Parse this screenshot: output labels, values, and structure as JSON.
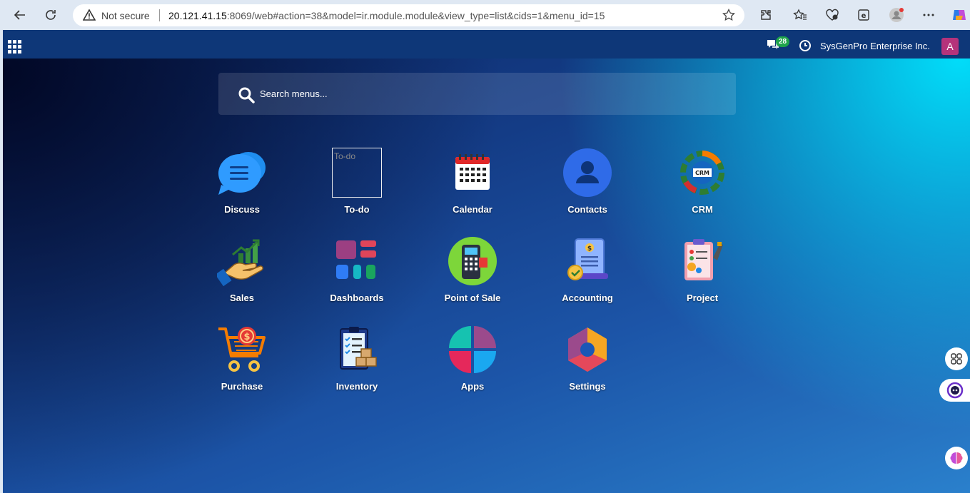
{
  "browser": {
    "security_label": "Not secure",
    "url_host": "20.121.41.15",
    "url_rest": ":8069/web#action=38&model=ir.module.module&view_type=list&cids=1&menu_id=15"
  },
  "navbar": {
    "messages_count": "28",
    "company_name": "SysGenPro Enterprise Inc.",
    "avatar_initial": "A"
  },
  "search": {
    "placeholder": "Search menus..."
  },
  "apps": [
    {
      "label": "Discuss",
      "icon": "chat-bubbles-icon"
    },
    {
      "label": "To-do",
      "icon": "broken-image-icon",
      "alt": "To-do"
    },
    {
      "label": "Calendar",
      "icon": "calendar-icon"
    },
    {
      "label": "Contacts",
      "icon": "person-icon"
    },
    {
      "label": "CRM",
      "icon": "crm-gear-icon"
    },
    {
      "label": "Sales",
      "icon": "sales-hand-icon"
    },
    {
      "label": "Dashboards",
      "icon": "dashboard-blocks-icon"
    },
    {
      "label": "Point of Sale",
      "icon": "pos-terminal-icon"
    },
    {
      "label": "Accounting",
      "icon": "accounting-document-icon"
    },
    {
      "label": "Project",
      "icon": "project-clipboard-icon"
    },
    {
      "label": "Purchase",
      "icon": "shopping-cart-icon"
    },
    {
      "label": "Inventory",
      "icon": "inventory-clipboard-icon"
    },
    {
      "label": "Apps",
      "icon": "apps-quadrants-icon"
    },
    {
      "label": "Settings",
      "icon": "settings-hexagon-icon"
    }
  ],
  "colors": {
    "navbar": "#0e3778",
    "badge": "#1fa34a",
    "avatar": "#b5337b"
  }
}
